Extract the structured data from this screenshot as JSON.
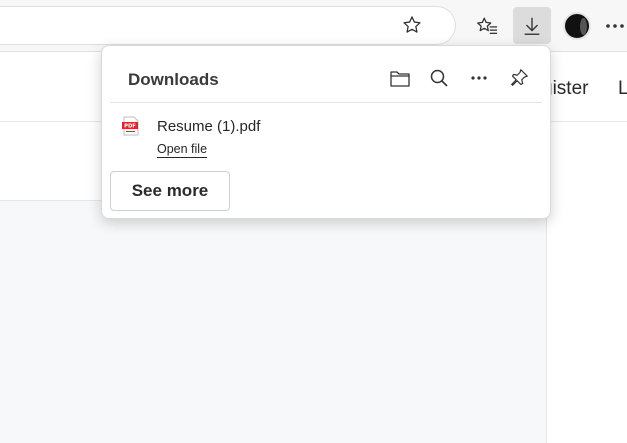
{
  "browser": {
    "favorites_star": "star-icon",
    "favorites": "favorites-icon",
    "downloads": "download-icon",
    "profile": "profile-avatar",
    "more": "more-icon"
  },
  "page": {
    "nav_register": "gister",
    "nav_partial": "L"
  },
  "downloads_panel": {
    "title": "Downloads",
    "actions": [
      "open-folder-icon",
      "search-icon",
      "more-options-icon",
      "pin-icon"
    ],
    "items": [
      {
        "file_name": "Resume (1).pdf",
        "action_label": "Open file",
        "icon": "pdf-file-icon",
        "icon_text": "PDF"
      }
    ],
    "see_more_label": "See more"
  },
  "colors": {
    "toolbar_bg": "#f7f7f7",
    "active_button": "#dcdcdc",
    "pdf_red": "#d7282f"
  }
}
